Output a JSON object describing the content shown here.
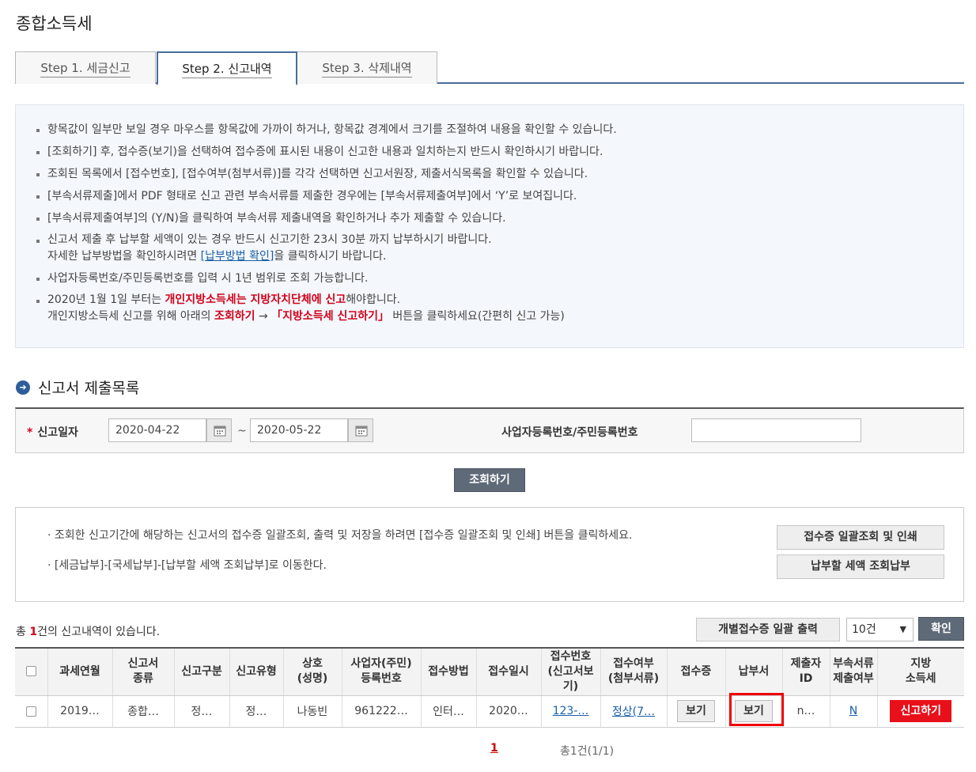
{
  "page": {
    "title": "종합소득세"
  },
  "tabs": [
    {
      "label": "Step 1. 세금신고"
    },
    {
      "label": "Step 2. 신고내역"
    },
    {
      "label": "Step 3. 삭제내역"
    }
  ],
  "notices": {
    "n1": "항목값이 일부만 보일 경우 마우스를 항목값에 가까이 하거나, 항목값 경계에서 크기를 조절하여 내용을 확인할 수 있습니다.",
    "n2": "[조회하기] 후, 접수증(보기)을 선택하여 접수증에 표시된 내용이 신고한 내용과 일치하는지 반드시 확인하시기 바랍니다.",
    "n3": "조회된 목록에서 [접수번호], [접수여부(첨부서류)]를 각각 선택하면 신고서원장, 제출서식목록을 확인할 수 있습니다.",
    "n4": "[부속서류제출]에서 PDF 형태로 신고 관련 부속서류를 제출한 경우에는 [부속서류제출여부]에서 ‘Y’로 보여집니다.",
    "n5": "[부속서류제출여부]의 (Y/N)을 클릭하여 부속서류 제출내역을 확인하거나 추가 제출할 수 있습니다.",
    "n6a": "신고서 제출 후 납부할 세액이 있는 경우 반드시 신고기한 23시 30분 까지 납부하시기 바랍니다.",
    "n6b_pre": "자세한 납부방법을 확인하시려면 ",
    "n6b_link": "[납부방법 확인]",
    "n6b_post": "을 클릭하시기 바랍니다.",
    "n7": "사업자등록번호/주민등록번호를 입력 시 1년 범위로 조회 가능합니다.",
    "n8a_pre": "2020년 1월 1일 부터는 ",
    "n8a_red": "개인지방소득세는 지방자치단체에 신고",
    "n8a_post": "해야합니다.",
    "n8b_pre": "개인지방소득세 신고를 위해 아래의 ",
    "n8b_red1": "조회하기",
    "n8b_arrow": " → ",
    "n8b_red2": "「지방소득세 신고하기」",
    "n8b_post": " 버튼을 클릭하세요(간편히 신고 가능)"
  },
  "section": {
    "title": "신고서 제출목록"
  },
  "search": {
    "date_label": "신고일자",
    "required_mark": "*",
    "from_date": "2020-04-22",
    "tilde": "~",
    "to_date": "2020-05-22",
    "id_label": "사업자등록번호/주민등록번호",
    "id_value": "",
    "search_button": "조회하기"
  },
  "info": {
    "line1": "· 조회한 신고기간에 해당하는 신고서의 접수증 일괄조회, 출력 및 저장을 하려면 [접수증 일괄조회 및 인쇄] 버튼을 클릭하세요.",
    "line2": "· [세금납부]-[국세납부]-[납부할 세액 조회납부]로 이동한다.",
    "batch_print_button": "접수증 일괄조회 및 인쇄",
    "pay_button": "납부할 세액 조회납부"
  },
  "list": {
    "total_pre": "총 ",
    "total_count": "1",
    "total_post": "건의 신고내역이 있습니다.",
    "individual_print_button": "개별접수증 일괄 출력",
    "page_size": "10건",
    "confirm_button": "확인"
  },
  "table": {
    "headers": {
      "period": "과세연월",
      "kind_1": "신고서",
      "kind_2": "종류",
      "category": "신고구분",
      "type": "신고유형",
      "name_1": "상호",
      "name_2": "(성명)",
      "reg_1": "사업자(주민)",
      "reg_2": "등록번호",
      "method": "접수방법",
      "date": "접수일시",
      "recv_1": "접수번호",
      "recv_2": "(신고서보기)",
      "status_1": "접수여부",
      "status_2": "(첨부서류)",
      "receipt": "접수증",
      "payment": "납부서",
      "submitter_1": "제출자",
      "submitter_2": "ID",
      "attach_1": "부속서류",
      "attach_2": "제출여부",
      "local_1": "지방",
      "local_2": "소득세"
    },
    "row": {
      "period": "2019…",
      "kind": "종합…",
      "category": "정…",
      "type": "정…",
      "name": "나동빈",
      "reg": "961222…",
      "method": "인터…",
      "date": "2020…",
      "recv": "123-…",
      "status": "정상(7…",
      "receipt_btn": "보기",
      "payment_btn": "보기",
      "submitter": "n…",
      "attach": "N",
      "local_btn": "신고하기"
    }
  },
  "pager": {
    "current": "1",
    "info": "총1건(1/1)"
  }
}
